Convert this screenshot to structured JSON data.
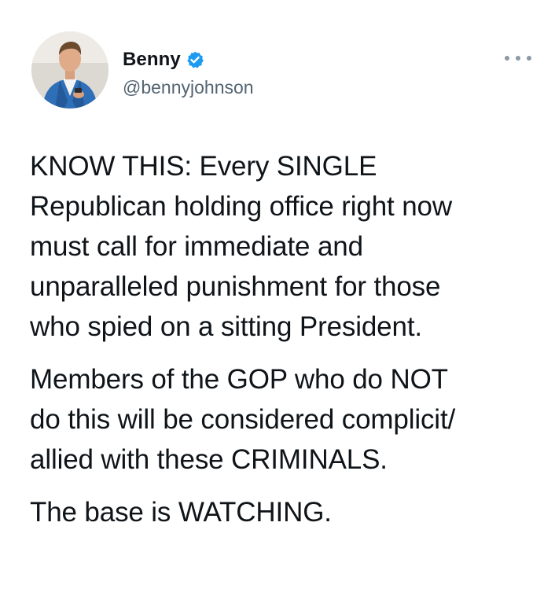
{
  "tweet": {
    "author": {
      "display_name": "Benny",
      "handle": "@bennyjohnson",
      "verified": true,
      "avatar_icon": "profile-photo"
    },
    "menu_icon": "more-dots-icon",
    "colors": {
      "verified_blue": "#1d9bf0",
      "text": "#0f1419",
      "muted": "#536471"
    },
    "paragraphs": [
      "KNOW THIS: Every SINGLE\nRepublican holding office right now\nmust call for immediate and\nunparalleled punishment for those\nwho spied on a sitting President.",
      "Members of the GOP who do NOT\ndo this will be considered complicit/\nallied with these CRIMINALS.",
      "The base is WATCHING."
    ]
  }
}
